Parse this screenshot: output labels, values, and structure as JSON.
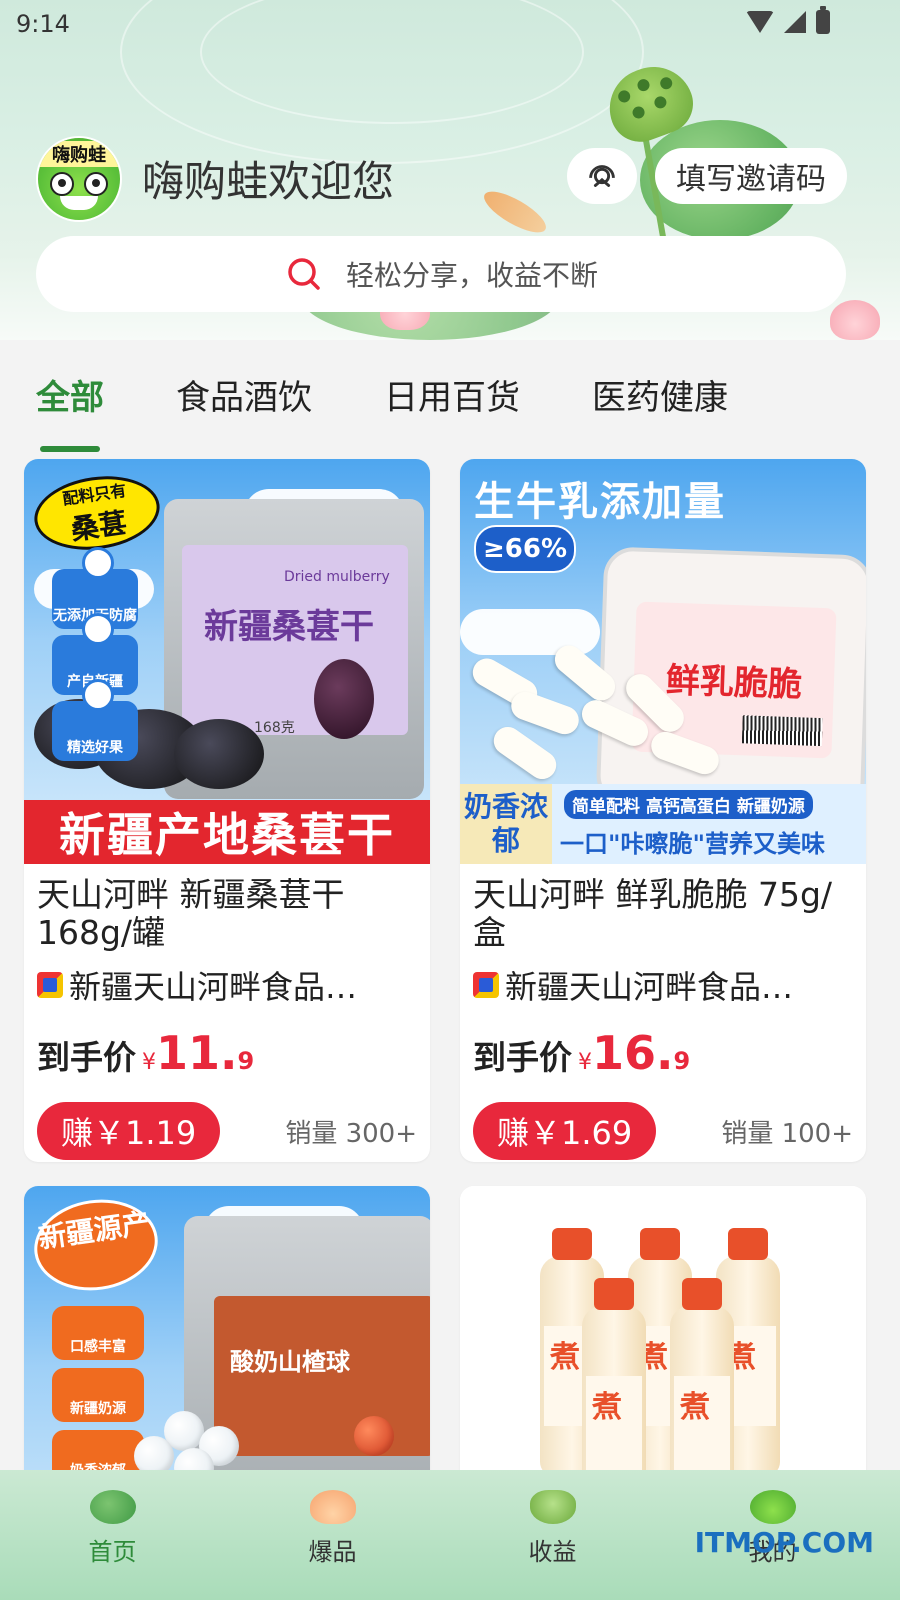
{
  "status_bar": {
    "time": "9:14"
  },
  "header": {
    "avatar_brand": "嗨购蛙",
    "welcome": "嗨购蛙欢迎您",
    "invite_button": "填写邀请码"
  },
  "search": {
    "placeholder": "轻松分享，收益不断"
  },
  "tabs": [
    {
      "label": "全部",
      "active": true
    },
    {
      "label": "食品酒饮",
      "active": false
    },
    {
      "label": "日用百货",
      "active": false
    },
    {
      "label": "医药健康",
      "active": false
    }
  ],
  "products": [
    {
      "title": "天山河畔 新疆桑葚干168g/罐",
      "shop": "新疆天山河畔食品…",
      "price_label": "到手价",
      "price_yen": "¥",
      "price_int": "11.",
      "price_dec": "9",
      "earn": "赚￥1.19",
      "sales": "销量 300+",
      "art": {
        "badge": "配料只有",
        "badge_main": "桑葚",
        "features": [
          "无添加无防腐",
          "产自新疆",
          "精选好果"
        ],
        "label": "新疆桑葚干",
        "label_en": "Dried mulberry",
        "weight": "168克",
        "banner": "新疆产地桑葚干"
      }
    },
    {
      "title": "天山河畔 鲜乳脆脆 75g/盒",
      "shop": "新疆天山河畔食品…",
      "price_label": "到手价",
      "price_yen": "¥",
      "price_int": "16.",
      "price_dec": "9",
      "earn": "赚￥1.69",
      "sales": "销量 100+",
      "art": {
        "top_text": "生牛乳添加量",
        "percent": "≥66%",
        "label": "鲜乳脆脆",
        "side": "奶香浓郁",
        "tags": "简单配料  高钙高蛋白  新疆奶源",
        "slogan": "一口\"咔嚓脆\"营养又美味"
      }
    },
    {
      "title": "",
      "art": {
        "badge": "新疆源产",
        "features": [
          "口感丰富",
          "新疆奶源",
          "奶香浓郁"
        ],
        "label": "酸奶山楂球"
      }
    },
    {
      "title": "",
      "art": {
        "bottle_text": "煮"
      }
    }
  ],
  "bottom_nav": [
    {
      "label": "首页",
      "icon": "lotus-leaf-icon",
      "active": true
    },
    {
      "label": "爆品",
      "icon": "lotus-flower-icon",
      "active": false
    },
    {
      "label": "收益",
      "icon": "lotus-pod-icon",
      "active": false
    },
    {
      "label": "我的",
      "icon": "frog-icon",
      "active": false
    }
  ],
  "watermark": "ITMOP.COM",
  "colors": {
    "accent_green": "#2e8b3a",
    "price_red": "#e8283c"
  }
}
